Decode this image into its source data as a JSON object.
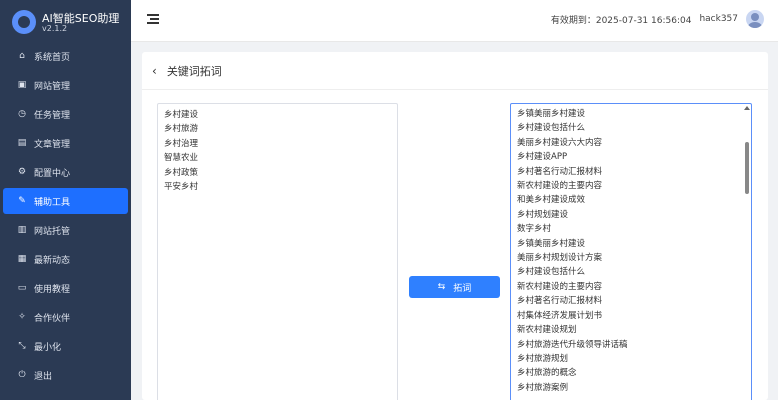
{
  "brand": {
    "name": "AI智能SEO助理",
    "version": "v2.1.2"
  },
  "nav": [
    {
      "label": "系统首页",
      "icon": "home-icon",
      "glyph": "⌂",
      "active": false
    },
    {
      "label": "网站管理",
      "icon": "site-icon",
      "glyph": "▣",
      "active": false
    },
    {
      "label": "任务管理",
      "icon": "clock-icon",
      "glyph": "◷",
      "active": false
    },
    {
      "label": "文章管理",
      "icon": "document-icon",
      "glyph": "▤",
      "active": false
    },
    {
      "label": "配置中心",
      "icon": "gear-icon",
      "glyph": "⚙",
      "active": false
    },
    {
      "label": "辅助工具",
      "icon": "wrench-icon",
      "glyph": "✎",
      "active": true
    },
    {
      "label": "网站托管",
      "icon": "hosting-icon",
      "glyph": "▥",
      "active": false
    },
    {
      "label": "最新动态",
      "icon": "news-icon",
      "glyph": "▦",
      "active": false
    },
    {
      "label": "使用教程",
      "icon": "monitor-icon",
      "glyph": "▭",
      "active": false
    },
    {
      "label": "合作伙伴",
      "icon": "partner-icon",
      "glyph": "✧",
      "active": false
    },
    {
      "label": "最小化",
      "icon": "minimize-icon",
      "glyph": "⤡",
      "active": false
    },
    {
      "label": "退出",
      "icon": "logout-icon",
      "glyph": "⏻",
      "active": false
    }
  ],
  "topbar": {
    "expiry": "有效期到：2025-07-31 16:56:04",
    "user": "hack357"
  },
  "page": {
    "title": "关键词拓词",
    "expand_label": "拓词"
  },
  "input_keywords": [
    "乡村建设",
    "乡村旅游",
    "乡村治理",
    "智慧农业",
    "乡村政策",
    "平安乡村"
  ],
  "results": [
    "乡镇美丽乡村建设",
    "乡村建设包括什么",
    "美丽乡村建设六大内容",
    "乡村建设APP",
    "乡村著名行动汇报材料",
    "新农村建设的主要内容",
    "和美乡村建设成效",
    "乡村规划建设",
    "数字乡村",
    "乡镇美丽乡村建设",
    "美丽乡村规划设计方案",
    "乡村建设包括什么",
    "新农村建设的主要内容",
    "乡村著名行动汇报材料",
    "村集体经济发展计划书",
    "新农村建设规划",
    "乡村旅游迭代升级领导讲话稿",
    "乡村旅游规划",
    "乡村旅游的概念",
    "乡村旅游案例"
  ]
}
